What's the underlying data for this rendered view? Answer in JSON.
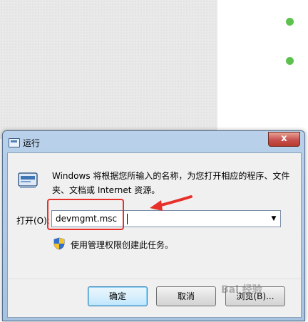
{
  "window": {
    "title": "运行",
    "close_glyph": "x"
  },
  "dialog": {
    "description": "Windows 将根据您所输入的名称，为您打开相应的程序、文件夹、文档或 Internet 资源。",
    "open_label": "打开(O):",
    "command_value": "devmgmt.msc",
    "dropdown_glyph": "▼",
    "admin_note": "使用管理权限创建此任务。"
  },
  "buttons": {
    "ok": "确定",
    "cancel": "取消",
    "browse": "浏览(B)..."
  },
  "watermark": "Bai 经验",
  "colors": {
    "highlight": "#e8302a",
    "dot": "#5cc24d"
  }
}
